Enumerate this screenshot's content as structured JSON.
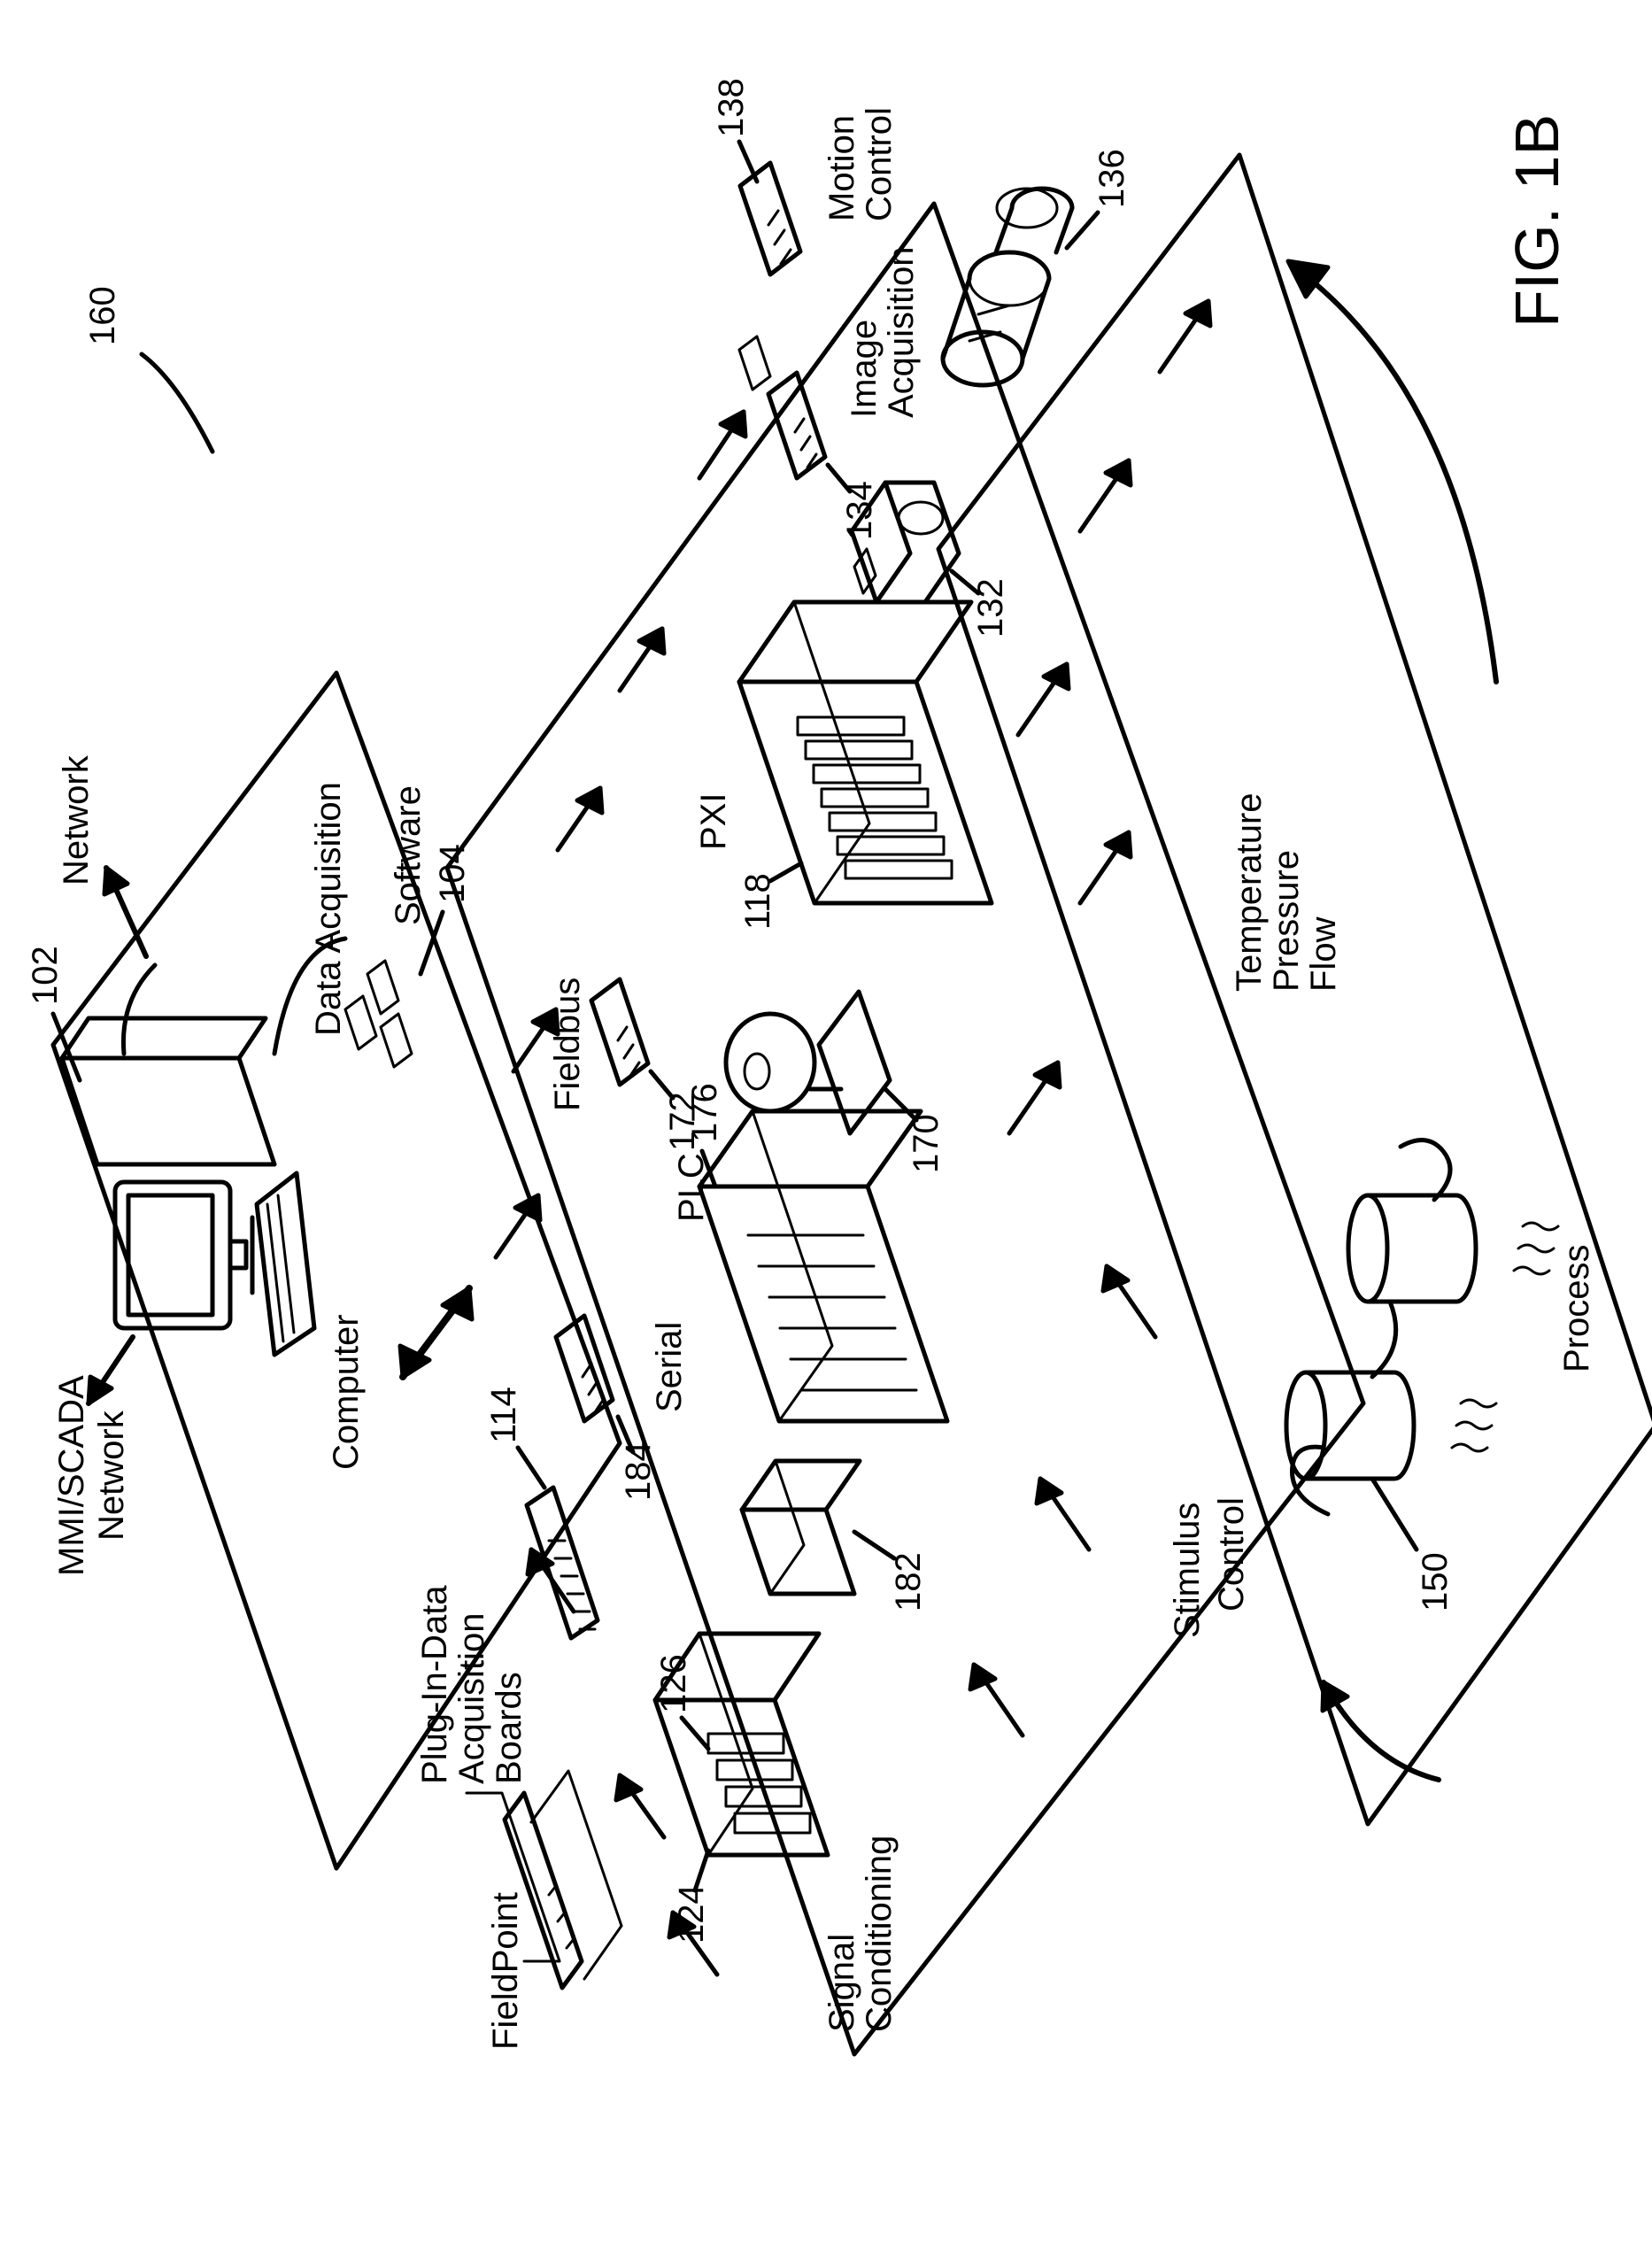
{
  "figure_label": "FIG. 1B",
  "system_ref": "160",
  "top": {
    "mmi": "MMI/SCADA",
    "network_l": "Network",
    "network_r": "Network",
    "computer_label": "Computer",
    "computer_ref": "102",
    "daq_label": "Data Acquisition",
    "software_label": "Software",
    "software_ref": "104"
  },
  "tier2": {
    "fieldpoint": "FieldPoint",
    "plugin_label": "Plug-In-Data\nAcquisition\nBoards",
    "plugin_ref": "114",
    "sigcond_label": "Signal\nConditioning",
    "sigcond_ref1": "124",
    "sigcond_ref2": "126",
    "box_ref": "182",
    "serial_label": "Serial",
    "serial_ref": "184",
    "plc_label": "PLC",
    "plc_ref": "176",
    "fieldbus_label": "Fieldbus",
    "fieldbus_ref": "172",
    "fieldbus_dev_ref": "170",
    "pxi_label": "PXI",
    "pxi_ref": "118",
    "cam_ref": "132",
    "imgacq_label": "Image\nAcquisition",
    "imgacq_ref": "134",
    "lens_ref": "136",
    "motion_label": "Motion\nControl",
    "motion_ref": "138"
  },
  "tier3": {
    "stimulus": "Stimulus",
    "control": "Control",
    "process_label": "Process",
    "process_ref": "150",
    "tpf": "Temperature\nPressure\nFlow"
  }
}
